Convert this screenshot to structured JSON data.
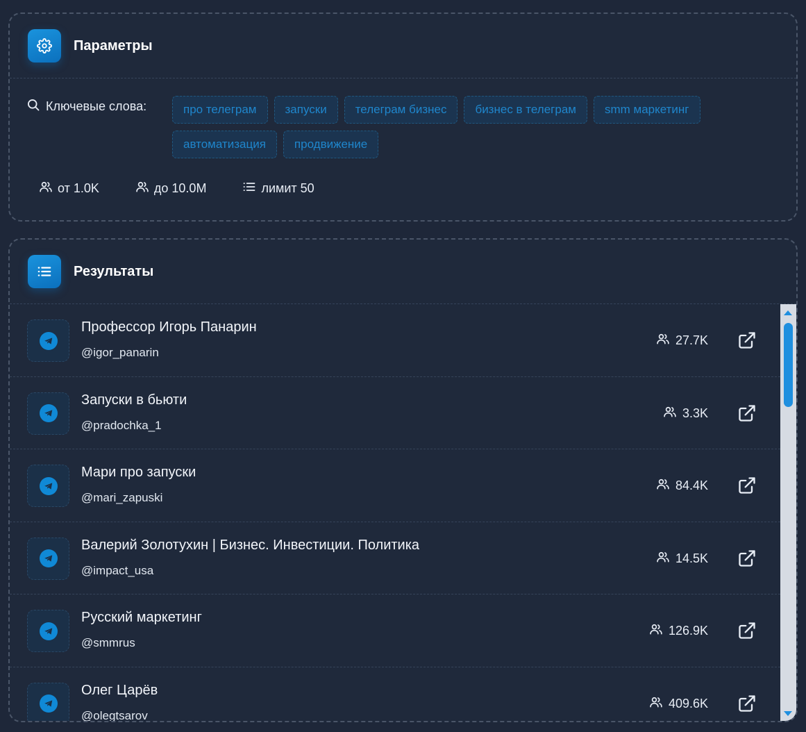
{
  "params": {
    "title": "Параметры",
    "keywords_label": "Ключевые слова:",
    "keywords": [
      "про телеграм",
      "запуски",
      "телеграм бизнес",
      "бизнес в телеграм",
      "smm маркетинг",
      "автоматизация",
      "продвижение"
    ],
    "min_subscribers": "от 1.0K",
    "max_subscribers": "до 10.0M",
    "limit": "лимит 50"
  },
  "results": {
    "title": "Результаты",
    "items": [
      {
        "name": "Профессор Игорь Панарин",
        "handle": "@igor_panarin",
        "subscribers": "27.7K"
      },
      {
        "name": "Запуски в бьюти",
        "handle": "@pradochka_1",
        "subscribers": "3.3K"
      },
      {
        "name": "Мари про запуски",
        "handle": "@mari_zapuski",
        "subscribers": "84.4K"
      },
      {
        "name": "Валерий Золотухин | Бизнес. Инвестиции. Политика",
        "handle": "@impact_usa",
        "subscribers": "14.5K"
      },
      {
        "name": "Русский маркетинг",
        "handle": "@smmrus",
        "subscribers": "126.9K"
      },
      {
        "name": "Олег Царёв",
        "handle": "@olegtsarov",
        "subscribers": "409.6K"
      }
    ]
  },
  "colors": {
    "background": "#1e2739",
    "accent": "#1089d6",
    "tag_text": "#1f86cc",
    "scrollbar_track": "#d6dbe3"
  },
  "icons": {
    "params_header": "gear-icon",
    "results_header": "list-icon",
    "keywords": "search-icon",
    "subscribers": "users-icon",
    "limit": "list-icon",
    "channel": "telegram-icon",
    "open": "external-link-icon"
  }
}
